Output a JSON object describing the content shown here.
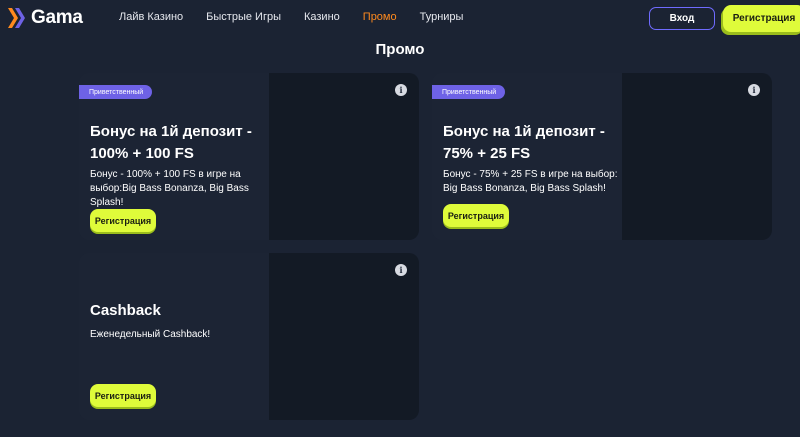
{
  "header": {
    "logo_text": "Gama",
    "nav": [
      "Лайв Казино",
      "Быстрые Игры",
      "Казино",
      "Промо",
      "Турниры"
    ],
    "active_nav": "Промо",
    "login_label": "Вход",
    "register_label": "Регистрация"
  },
  "page": {
    "title": "Промо"
  },
  "promos": [
    {
      "badge": "Приветственный",
      "title": "Бонус на 1й депозит - 100% + 100 FS",
      "description": "Бонус - 100% + 100 FS в игре на выбор:Big Bass Bonanza, Big Bass Splash!",
      "button": "Регистрация",
      "info_icon": "info-icon"
    },
    {
      "badge": "Приветственный",
      "title": "Бонус на 1й депозит - 75% + 25 FS",
      "description": "Бонус - 75% + 25 FS в игре на выбор: Big Bass Bonanza, Big Bass Splash!",
      "button": "Регистрация",
      "info_icon": "info-icon"
    },
    {
      "title": "Cashback",
      "description": "Еженедельный Cashback!",
      "button": "Регистрация",
      "info_icon": "info-icon"
    }
  ],
  "colors": {
    "background": "#1b2333",
    "accent_green": "#dffb3a",
    "accent_orange": "#ff8a1e",
    "accent_purple": "#6e62e6",
    "login_border": "#6f6bff"
  }
}
